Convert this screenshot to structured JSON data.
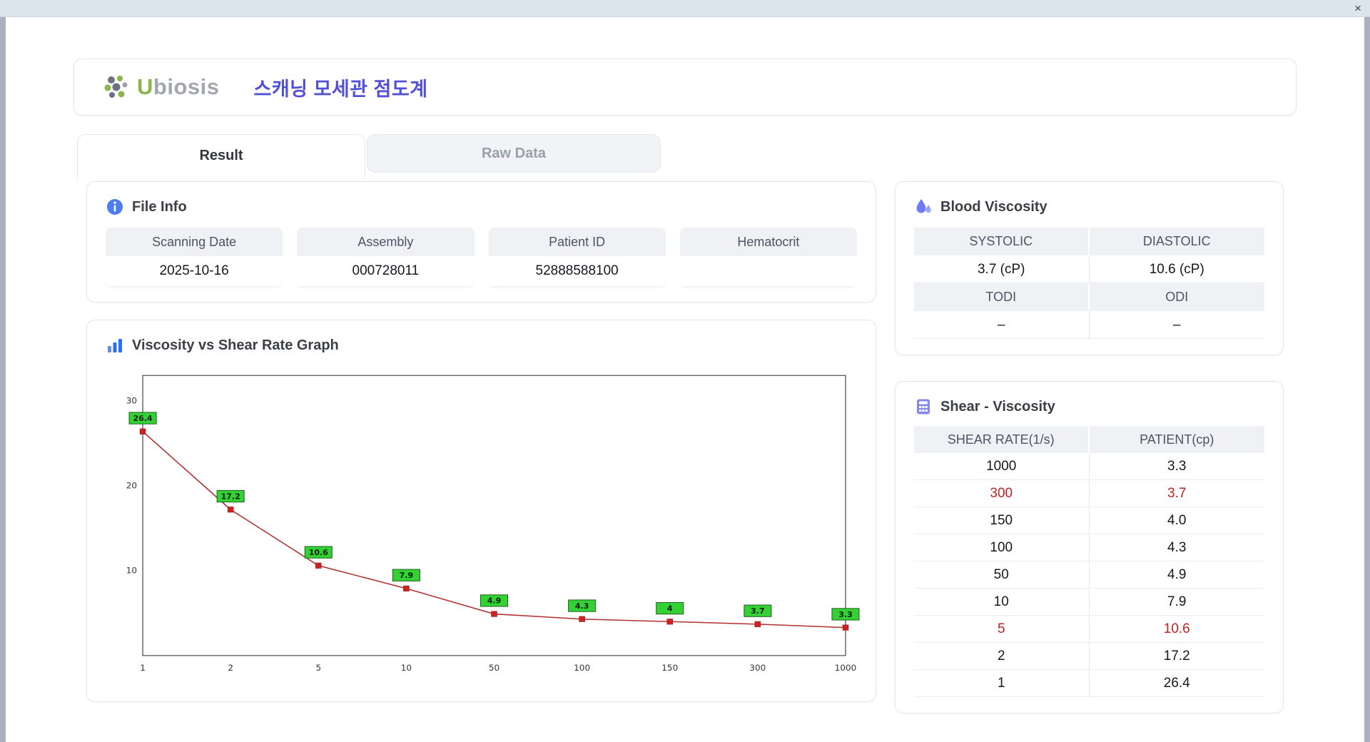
{
  "window": {
    "close_label": "×"
  },
  "header": {
    "logo_u": "U",
    "logo_rest": "biosis",
    "title": "스캐닝 모세관 점도계"
  },
  "tabs": [
    {
      "label": "Result",
      "active": true
    },
    {
      "label": "Raw Data",
      "active": false
    }
  ],
  "file_info": {
    "section_title": "File Info",
    "fields": [
      {
        "label": "Scanning Date",
        "value": "2025-10-16"
      },
      {
        "label": "Assembly",
        "value": "000728011"
      },
      {
        "label": "Patient ID",
        "value": "52888588100"
      },
      {
        "label": "Hematocrit",
        "value": ""
      }
    ]
  },
  "blood_viscosity": {
    "section_title": "Blood Viscosity",
    "cells": [
      {
        "label": "SYSTOLIC",
        "value": "3.7 (cP)"
      },
      {
        "label": "DIASTOLIC",
        "value": "10.6 (cP)"
      },
      {
        "label": "TODI",
        "value": "–"
      },
      {
        "label": "ODI",
        "value": "–"
      }
    ]
  },
  "graph": {
    "section_title": "Viscosity vs Shear Rate Graph"
  },
  "chart_data": {
    "type": "line",
    "title": "Viscosity vs Shear Rate Graph",
    "xlabel": "",
    "ylabel": "",
    "x": [
      1,
      2,
      5,
      10,
      50,
      100,
      150,
      300,
      1000
    ],
    "values": [
      26.4,
      17.2,
      10.6,
      7.9,
      4.9,
      4.3,
      4,
      3.7,
      3.3
    ],
    "point_labels": [
      "26.4",
      "17.2",
      "10.6",
      "7.9",
      "4.9",
      "4.3",
      "4",
      "3.7",
      "3.3"
    ],
    "yticks": [
      10,
      20,
      30
    ],
    "ylim": [
      0,
      33
    ],
    "grid": true,
    "x_spacing": "even-categorical",
    "line_color": "#b03030",
    "marker_color": "#cc2222",
    "label_bg": "#33d133"
  },
  "shear_table": {
    "section_title": "Shear - Viscosity",
    "columns": [
      "SHEAR RATE(1/s)",
      "PATIENT(cp)"
    ],
    "rows": [
      {
        "shear": "1000",
        "patient": "3.3",
        "highlight": false
      },
      {
        "shear": "300",
        "patient": "3.7",
        "highlight": true
      },
      {
        "shear": "150",
        "patient": "4.0",
        "highlight": false
      },
      {
        "shear": "100",
        "patient": "4.3",
        "highlight": false
      },
      {
        "shear": "50",
        "patient": "4.9",
        "highlight": false
      },
      {
        "shear": "10",
        "patient": "7.9",
        "highlight": false
      },
      {
        "shear": "5",
        "patient": "10.6",
        "highlight": true
      },
      {
        "shear": "2",
        "patient": "17.2",
        "highlight": false
      },
      {
        "shear": "1",
        "patient": "26.4",
        "highlight": false
      }
    ]
  },
  "colors": {
    "accent_indigo": "#5150d6",
    "highlight_red": "#c32222",
    "logo_green": "#8bb54a",
    "chart_line": "#b03030",
    "chart_label_green": "#33d133"
  }
}
